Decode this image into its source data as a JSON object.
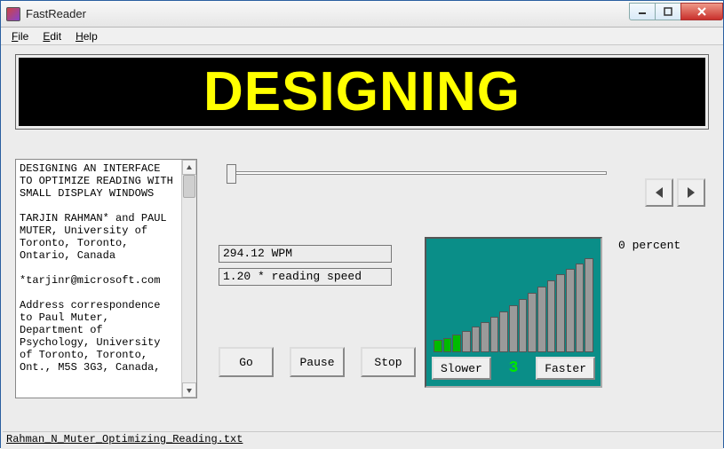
{
  "window": {
    "title": "FastReader"
  },
  "menu": {
    "file": "File",
    "edit": "Edit",
    "help": "Help"
  },
  "display_word": "DESIGNING",
  "document_text": "DESIGNING AN INTERFACE TO OPTIMIZE READING WITH SMALL DISPLAY WINDOWS\n\nTARJIN RAHMAN* and PAUL MUTER, University of Toronto, Toronto, Ontario, Canada\n\n*tarjinr@microsoft.com\n\nAddress correspondence to Paul Muter, Department of Psychology, University of Toronto, Toronto, Ont., M5S 3G3, Canada,",
  "progress": {
    "percent_label": "0 percent"
  },
  "metrics": {
    "wpm": "294.12 WPM",
    "speed_text": "1.20 * reading speed"
  },
  "controls": {
    "go": "Go",
    "pause": "Pause",
    "stop": "Stop"
  },
  "speed": {
    "slower": "Slower",
    "faster": "Faster",
    "level": "3",
    "active_bars": 3,
    "total_bars": 17,
    "bar_heights": [
      14,
      16,
      20,
      24,
      29,
      34,
      40,
      46,
      53,
      60,
      67,
      74,
      81,
      88,
      94,
      100,
      106
    ]
  },
  "status": {
    "filename": "Rahman_N_Muter_Optimizing_Reading.txt"
  }
}
